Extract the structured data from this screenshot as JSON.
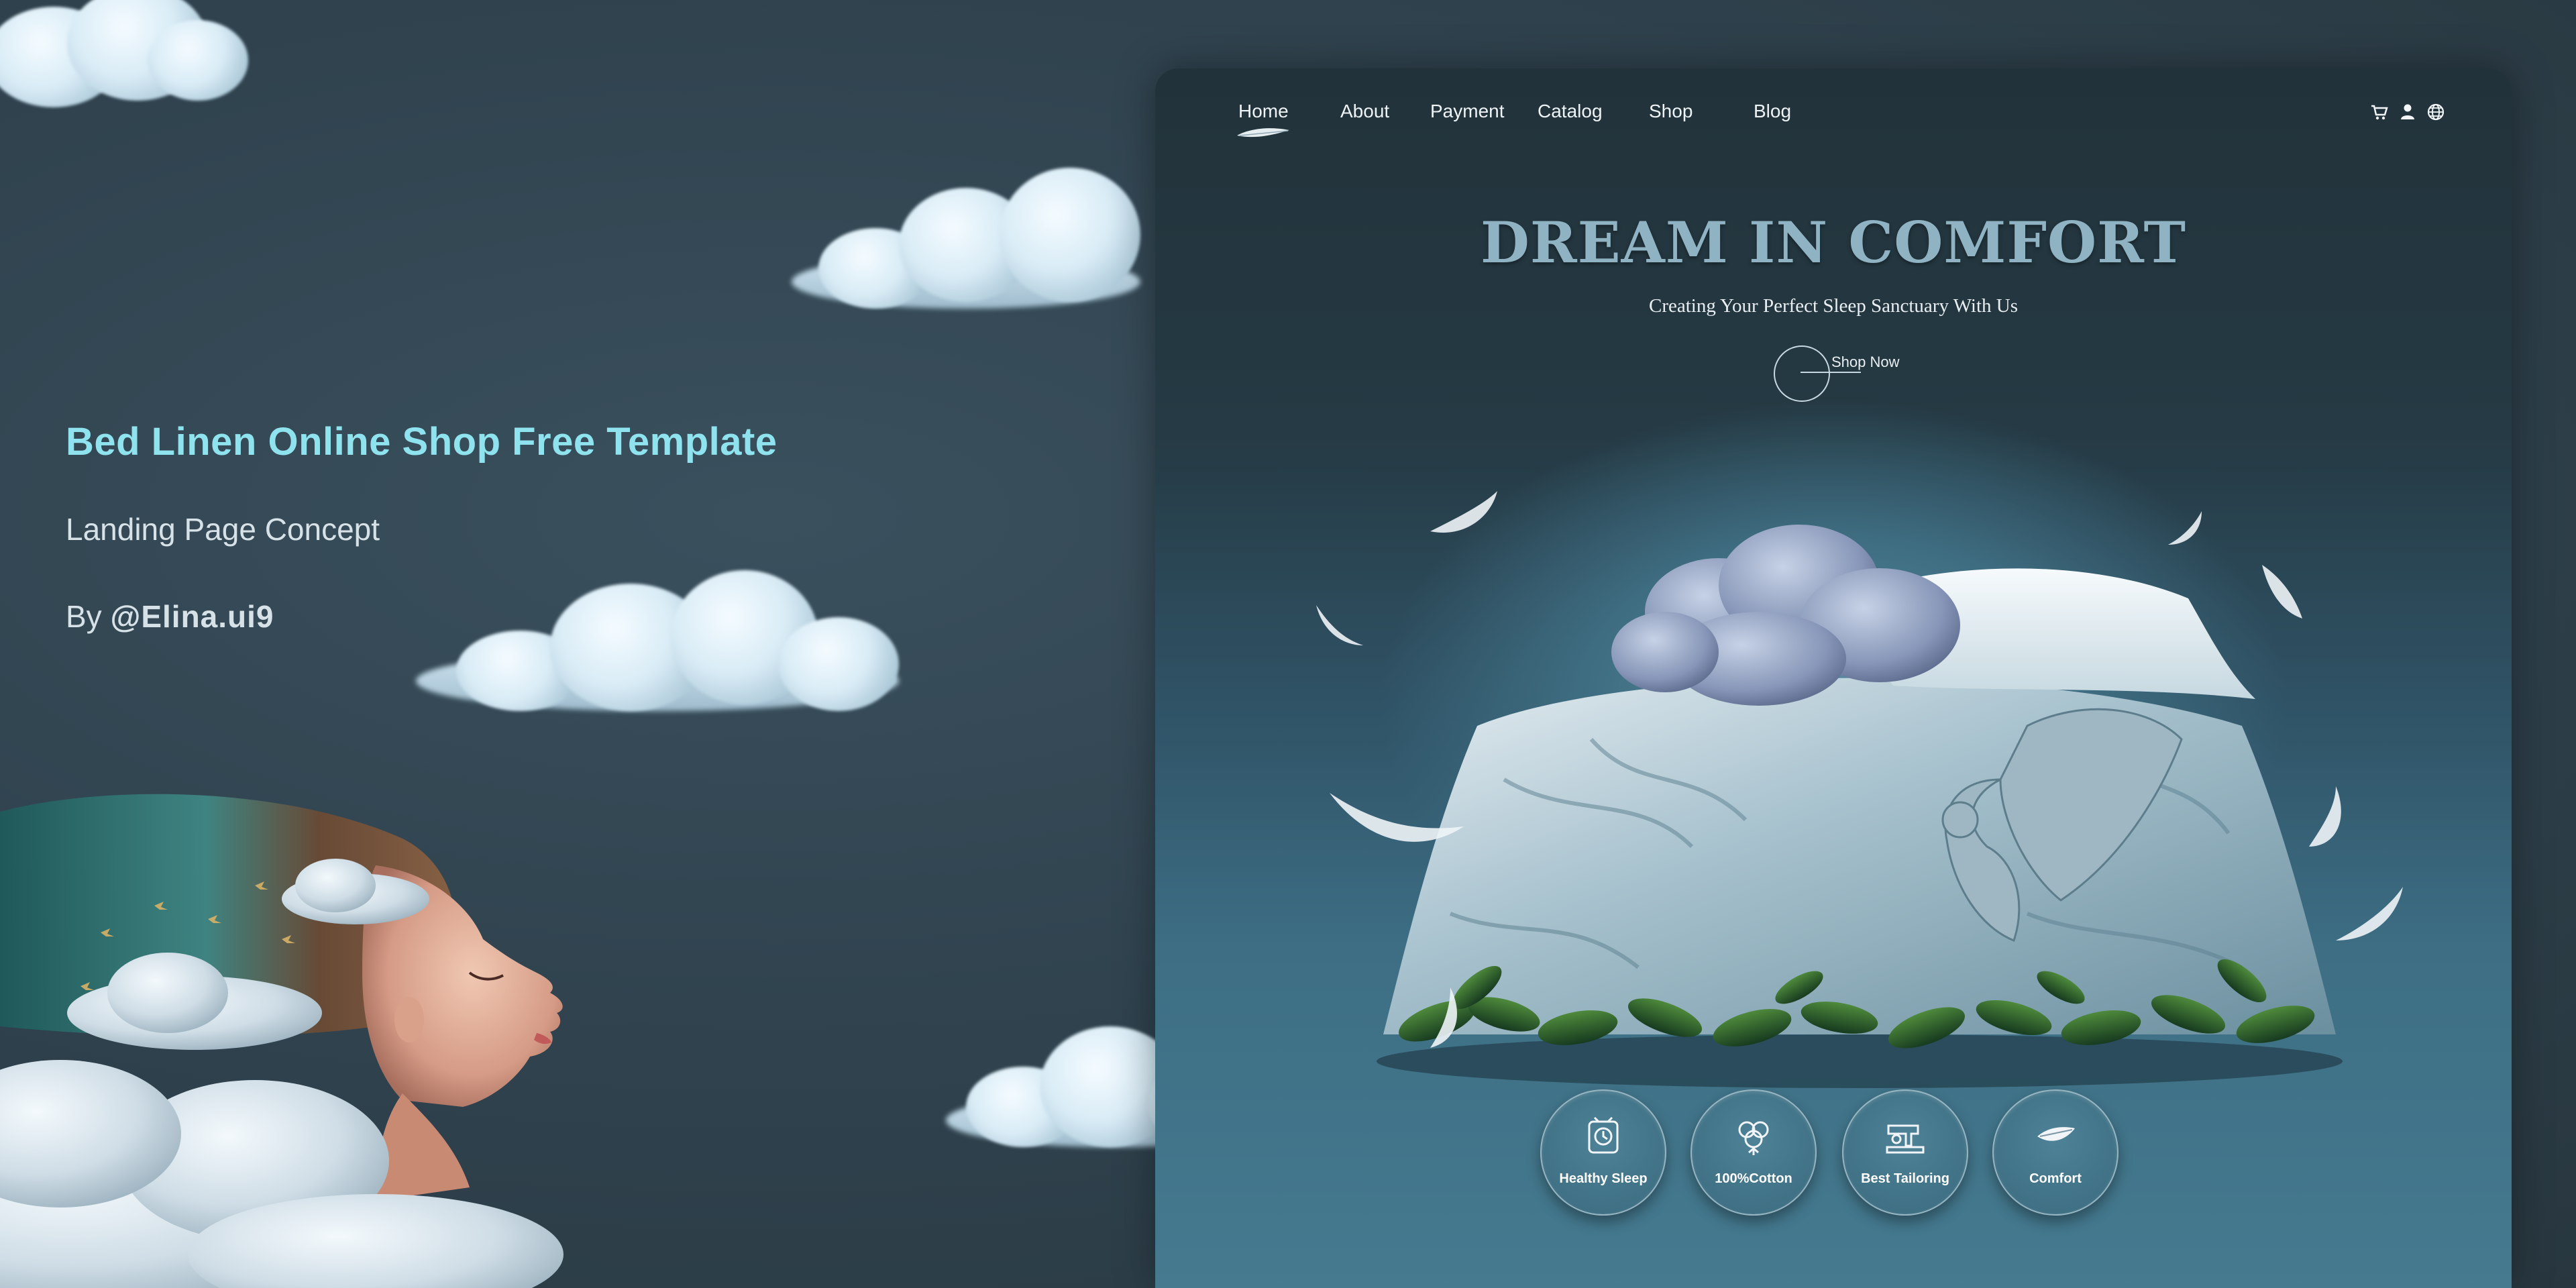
{
  "left": {
    "title": "Bed Linen Online Shop Free Template",
    "subtitle": "Landing Page Concept",
    "by_prefix": "By ",
    "author": "@Elina.ui9"
  },
  "mockup": {
    "nav": {
      "items": [
        {
          "label": "Home",
          "active": true
        },
        {
          "label": "About"
        },
        {
          "label": "Payment"
        },
        {
          "label": "Catalog"
        },
        {
          "label": "Shop"
        },
        {
          "label": "Blog"
        }
      ],
      "icons": [
        "cart-icon",
        "user-icon",
        "globe-icon"
      ]
    },
    "hero": {
      "title": "DREAM IN COMFORT",
      "subtitle": "Creating Your Perfect Sleep Sanctuary With Us",
      "cta_label": "Shop Now"
    },
    "features": [
      {
        "label": "Healthy Sleep",
        "icon": "sleep-clock-icon"
      },
      {
        "label": "100%Cotton",
        "icon": "cotton-icon"
      },
      {
        "label": "Best Tailoring",
        "icon": "sewing-machine-icon"
      },
      {
        "label": "Comfort",
        "icon": "feather-icon"
      }
    ]
  },
  "colors": {
    "accent": "#8fe3ee",
    "background": "#30434f",
    "hero_title": "#8fb3c3"
  }
}
